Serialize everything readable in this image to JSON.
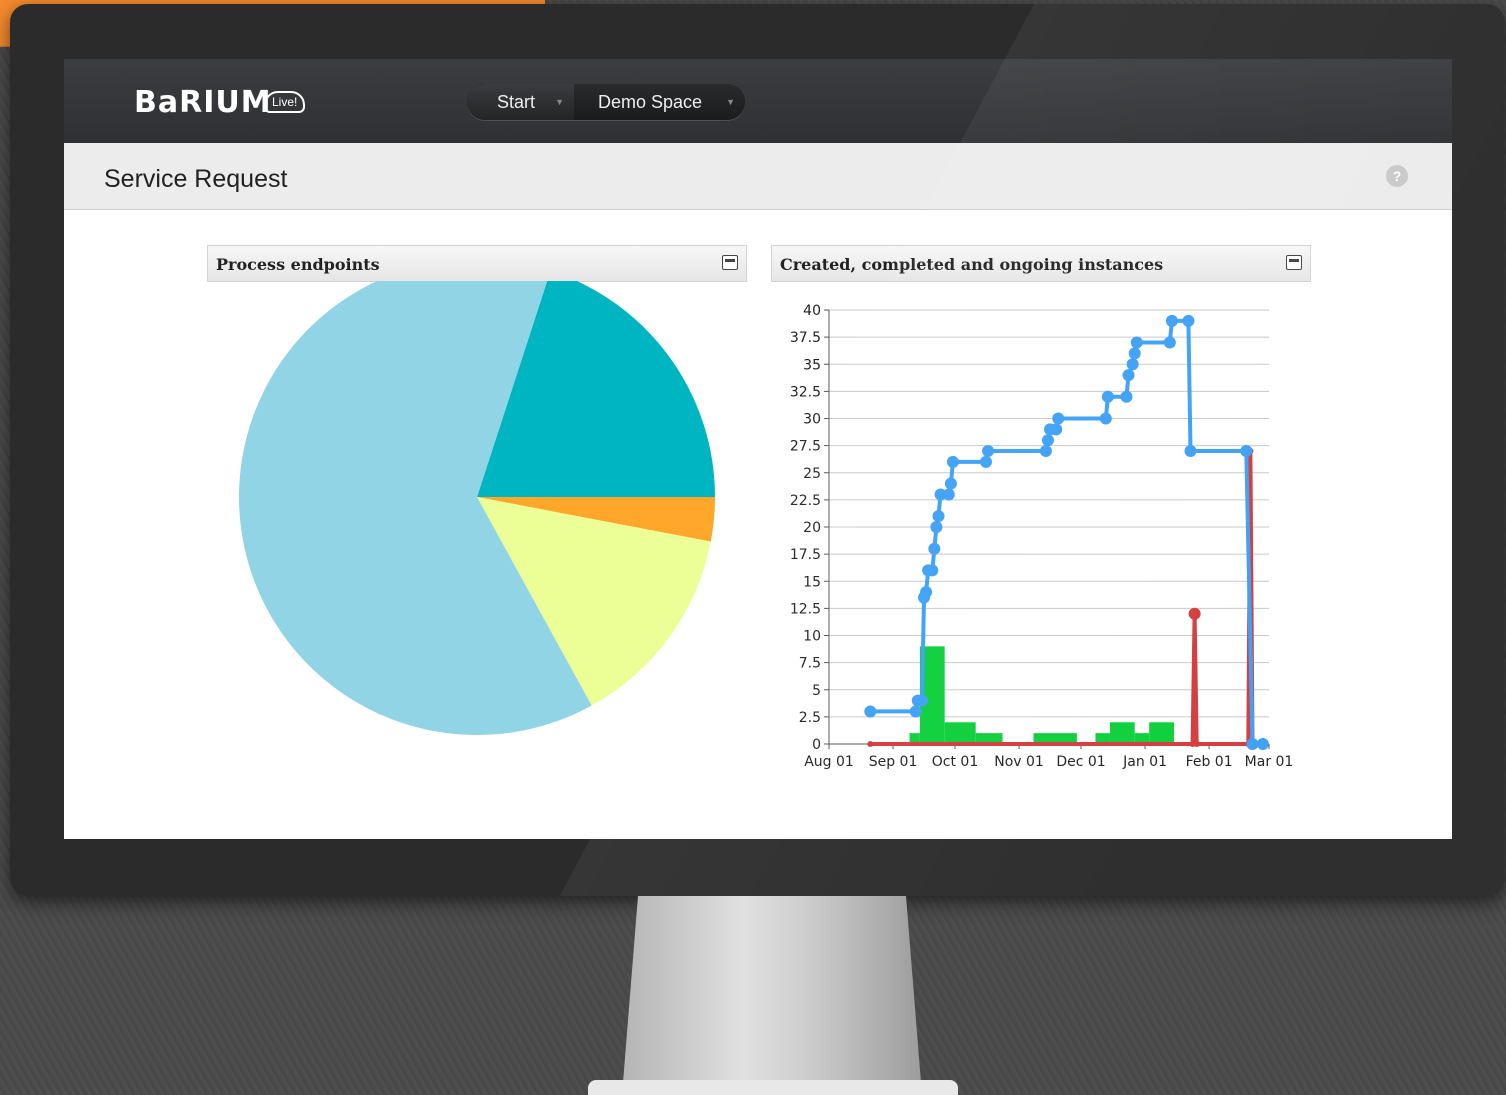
{
  "banner": {
    "text": ""
  },
  "app": {
    "logo": "BaRIUM",
    "logo_sub": "Live!",
    "nav": {
      "start": "Start",
      "space": "Demo Space"
    },
    "page_title": "Service Request"
  },
  "icons": {
    "help": "help-icon",
    "minimize": "minimize-icon",
    "caret": "caret-down-icon"
  },
  "panels": {
    "left_title": "Process endpoints",
    "right_title": "Created, completed and ongoing instances"
  },
  "colors": {
    "pie": [
      "#00b5c2",
      "#ffa72a",
      "#ebff96",
      "#90d4e6"
    ],
    "line_blue": "#3da0f5",
    "line_red": "#d43b3b",
    "bar_green": "#0ccf3a"
  },
  "chart_data": [
    {
      "type": "pie",
      "title": "Process endpoints",
      "slices": [
        {
          "value": 20,
          "color": "#00b5c2"
        },
        {
          "value": 3,
          "color": "#ffa72a"
        },
        {
          "value": 14,
          "color": "#ebff96"
        },
        {
          "value": 63,
          "color": "#90d4e6"
        }
      ]
    },
    {
      "type": "line",
      "title": "Created, completed and ongoing instances",
      "x_ticks": [
        "Aug 01",
        "Sep 01",
        "Oct 01",
        "Nov 01",
        "Dec 01",
        "Jan 01",
        "Feb 01",
        "Mar 01"
      ],
      "y_ticks": [
        "0",
        "2.5",
        "5",
        "7.5",
        "10",
        "12.5",
        "15",
        "17.5",
        "20",
        "22.5",
        "25",
        "27.5",
        "30",
        "32.5",
        "35",
        "37.5",
        "40"
      ],
      "ylim": [
        0,
        40
      ],
      "xlim": [
        "2023-08-01",
        "2024-03-01"
      ],
      "grid": true,
      "series": [
        {
          "color": "#3da0f5",
          "points": [
            [
              "2023-08-21",
              3
            ],
            [
              "2023-09-12",
              3
            ],
            [
              "2023-09-13",
              4
            ],
            [
              "2023-09-15",
              4
            ],
            [
              "2023-09-16",
              13.5
            ],
            [
              "2023-09-17",
              14
            ],
            [
              "2023-09-18",
              16
            ],
            [
              "2023-09-20",
              16
            ],
            [
              "2023-09-21",
              18
            ],
            [
              "2023-09-22",
              20
            ],
            [
              "2023-09-23",
              21
            ],
            [
              "2023-09-24",
              23
            ],
            [
              "2023-09-28",
              23
            ],
            [
              "2023-09-29",
              24
            ],
            [
              "2023-09-30",
              26
            ],
            [
              "2023-10-16",
              26
            ],
            [
              "2023-10-17",
              27
            ],
            [
              "2023-11-14",
              27
            ],
            [
              "2023-11-15",
              28
            ],
            [
              "2023-11-16",
              29
            ],
            [
              "2023-11-19",
              29
            ],
            [
              "2023-11-20",
              30
            ],
            [
              "2023-12-13",
              30
            ],
            [
              "2023-12-14",
              32
            ],
            [
              "2023-12-23",
              32
            ],
            [
              "2023-12-24",
              34
            ],
            [
              "2023-12-26",
              35
            ],
            [
              "2023-12-27",
              36
            ],
            [
              "2023-12-28",
              37
            ],
            [
              "2024-01-13",
              37
            ],
            [
              "2024-01-14",
              39
            ],
            [
              "2024-01-22",
              39
            ],
            [
              "2024-01-23",
              27
            ],
            [
              "2024-02-19",
              27
            ],
            [
              "2024-02-22",
              0
            ],
            [
              "2024-02-27",
              0
            ]
          ]
        },
        {
          "color": "#d43b3b",
          "points": [
            [
              "2023-08-21",
              0
            ],
            [
              "2024-01-24",
              0
            ],
            [
              "2024-01-25",
              12
            ],
            [
              "2024-01-26",
              0
            ],
            [
              "2024-02-20",
              0
            ],
            [
              "2024-02-21",
              27
            ],
            [
              "2024-02-22",
              0
            ]
          ]
        },
        {
          "type": "bar",
          "color": "#0ccf3a",
          "bars": [
            [
              "2023-09-09",
              "2023-09-14",
              1
            ],
            [
              "2023-09-14",
              "2023-09-26",
              9
            ],
            [
              "2023-09-26",
              "2023-10-11",
              2
            ],
            [
              "2023-10-11",
              "2023-10-24",
              1
            ],
            [
              "2023-11-08",
              "2023-11-29",
              1
            ],
            [
              "2023-12-08",
              "2023-12-15",
              1
            ],
            [
              "2023-12-15",
              "2023-12-27",
              2
            ],
            [
              "2023-12-27",
              "2024-01-03",
              1
            ],
            [
              "2024-01-03",
              "2024-01-15",
              2
            ]
          ]
        }
      ]
    }
  ]
}
